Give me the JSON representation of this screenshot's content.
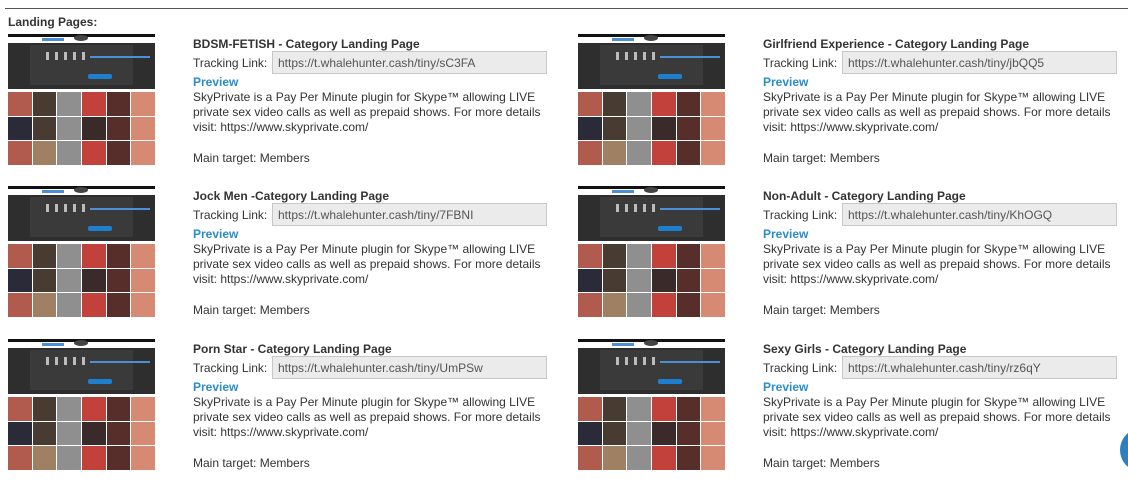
{
  "section": {
    "title": "Landing Pages:"
  },
  "labels": {
    "tracking": "Tracking Link:",
    "preview": "Preview",
    "main_target": "Main target: Members"
  },
  "description": "SkyPrivate is a Pay Per Minute plugin for Skype™ allowing LIVE private sex video calls as well as prepaid shows. For more details visit: https://www.skyprivate.com/",
  "pages": [
    {
      "title": "BDSM-FETISH - Category Landing Page",
      "link": "https://t.whalehunter.cash/tiny/sC3FA"
    },
    {
      "title": "Girlfriend Experience - Category Landing Page",
      "link": "https://t.whalehunter.cash/tiny/jbQQ5"
    },
    {
      "title": "Jock Men -Category Landing Page",
      "link": "https://t.whalehunter.cash/tiny/7FBNI"
    },
    {
      "title": "Non-Adult - Category Landing Page",
      "link": "https://t.whalehunter.cash/tiny/KhOGQ"
    },
    {
      "title": "Porn Star - Category Landing Page",
      "link": "https://t.whalehunter.cash/tiny/UmPSw"
    },
    {
      "title": "Sexy Girls - Category Landing Page",
      "link": "https://t.whalehunter.cash/tiny/rz6qY"
    }
  ],
  "colors": {
    "link": "#2a8dc7",
    "input_bg": "#ebebeb",
    "chat": "#2c7fc2"
  }
}
